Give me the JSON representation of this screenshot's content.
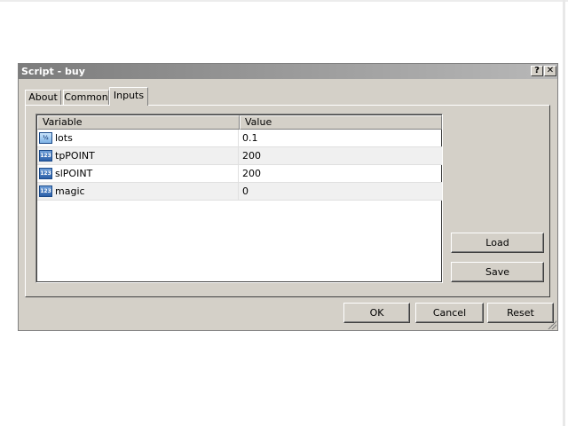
{
  "window": {
    "title": "Script - buy",
    "help_label": "?",
    "close_label": "✕"
  },
  "tabs": [
    {
      "label": "About"
    },
    {
      "label": "Common"
    },
    {
      "label": "Inputs",
      "active": true
    }
  ],
  "grid": {
    "headers": [
      "Variable",
      "Value"
    ],
    "rows": [
      {
        "name": "lots",
        "value": "0.1",
        "icon": "fraction-type-icon",
        "icon_text": "½"
      },
      {
        "name": "tpPOINT",
        "value": "200",
        "icon": "integer-type-icon",
        "icon_text": "123"
      },
      {
        "name": "slPOINT",
        "value": "200",
        "icon": "integer-type-icon",
        "icon_text": "123"
      },
      {
        "name": "magic",
        "value": "0",
        "icon": "integer-type-icon",
        "icon_text": "123"
      }
    ]
  },
  "side_buttons": {
    "load": "Load",
    "save": "Save"
  },
  "footer_buttons": {
    "ok": "OK",
    "cancel": "Cancel",
    "reset": "Reset"
  }
}
